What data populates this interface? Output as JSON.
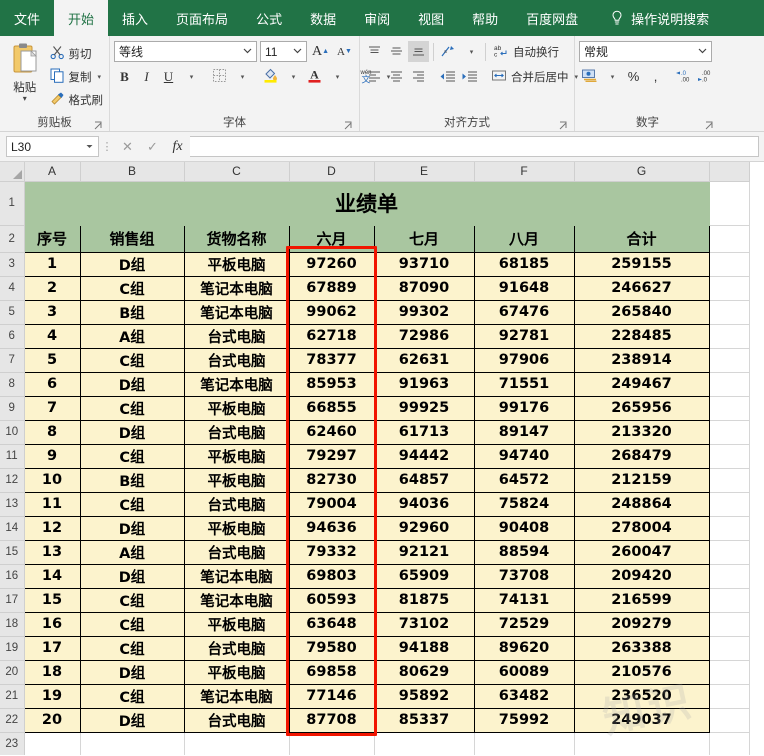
{
  "ribbon": {
    "tabs": [
      {
        "label": "文件",
        "active": false
      },
      {
        "label": "开始",
        "active": true
      },
      {
        "label": "插入",
        "active": false
      },
      {
        "label": "页面布局",
        "active": false
      },
      {
        "label": "公式",
        "active": false
      },
      {
        "label": "数据",
        "active": false
      },
      {
        "label": "审阅",
        "active": false
      },
      {
        "label": "视图",
        "active": false
      },
      {
        "label": "帮助",
        "active": false
      },
      {
        "label": "百度网盘",
        "active": false
      }
    ],
    "tellme": "操作说明搜索",
    "tellme_icon": "lightbulb-icon",
    "groups": {
      "clipboard": {
        "label": "剪贴板",
        "paste": "粘贴",
        "cut": "剪切",
        "copy": "复制",
        "format_painter": "格式刷"
      },
      "font": {
        "label": "字体",
        "font_name": "等线",
        "font_size": "11",
        "bold": "B",
        "italic": "I",
        "underline": "U",
        "grow_font": "A",
        "shrink_font": "A",
        "phonetic": "wén 文"
      },
      "alignment": {
        "label": "对齐方式",
        "wrap_text": "自动换行",
        "merge_center": "合并后居中"
      },
      "number": {
        "label": "数字",
        "format": "常规",
        "percent": "%",
        "comma": ","
      }
    }
  },
  "formula_bar": {
    "name_box": "L30",
    "cancel": "✕",
    "enter": "✓",
    "fx": "fx",
    "formula": ""
  },
  "grid": {
    "columns": [
      "A",
      "B",
      "C",
      "D",
      "E",
      "F",
      "G"
    ],
    "rows": [
      "1",
      "2",
      "3",
      "4",
      "5",
      "6",
      "7",
      "8",
      "9",
      "10",
      "11",
      "12",
      "13",
      "14",
      "15",
      "16",
      "17",
      "18",
      "19",
      "20",
      "21",
      "22",
      "23"
    ],
    "title": "业绩单",
    "headers": [
      "序号",
      "销售组",
      "货物名称",
      "六月",
      "七月",
      "八月",
      "合计"
    ],
    "data": [
      [
        "1",
        "D组",
        "平板电脑",
        "97260",
        "93710",
        "68185",
        "259155"
      ],
      [
        "2",
        "C组",
        "笔记本电脑",
        "67889",
        "87090",
        "91648",
        "246627"
      ],
      [
        "3",
        "B组",
        "笔记本电脑",
        "99062",
        "99302",
        "67476",
        "265840"
      ],
      [
        "4",
        "A组",
        "台式电脑",
        "62718",
        "72986",
        "92781",
        "228485"
      ],
      [
        "5",
        "C组",
        "台式电脑",
        "78377",
        "62631",
        "97906",
        "238914"
      ],
      [
        "6",
        "D组",
        "笔记本电脑",
        "85953",
        "91963",
        "71551",
        "249467"
      ],
      [
        "7",
        "C组",
        "平板电脑",
        "66855",
        "99925",
        "99176",
        "265956"
      ],
      [
        "8",
        "D组",
        "台式电脑",
        "62460",
        "61713",
        "89147",
        "213320"
      ],
      [
        "9",
        "C组",
        "平板电脑",
        "79297",
        "94442",
        "94740",
        "268479"
      ],
      [
        "10",
        "B组",
        "平板电脑",
        "82730",
        "64857",
        "64572",
        "212159"
      ],
      [
        "11",
        "C组",
        "台式电脑",
        "79004",
        "94036",
        "75824",
        "248864"
      ],
      [
        "12",
        "D组",
        "平板电脑",
        "94636",
        "92960",
        "90408",
        "278004"
      ],
      [
        "13",
        "A组",
        "台式电脑",
        "79332",
        "92121",
        "88594",
        "260047"
      ],
      [
        "14",
        "D组",
        "笔记本电脑",
        "69803",
        "65909",
        "73708",
        "209420"
      ],
      [
        "15",
        "C组",
        "笔记本电脑",
        "60593",
        "81875",
        "74131",
        "216599"
      ],
      [
        "16",
        "C组",
        "平板电脑",
        "63648",
        "73102",
        "72529",
        "209279"
      ],
      [
        "17",
        "C组",
        "台式电脑",
        "79580",
        "94188",
        "89620",
        "263388"
      ],
      [
        "18",
        "D组",
        "平板电脑",
        "69858",
        "80629",
        "60089",
        "210576"
      ],
      [
        "19",
        "C组",
        "笔记本电脑",
        "77146",
        "95892",
        "63482",
        "236520"
      ],
      [
        "20",
        "D组",
        "台式电脑",
        "87708",
        "85337",
        "75992",
        "249037"
      ]
    ],
    "annotation": {
      "type": "red-rectangle",
      "target_column": "D",
      "color": "#f11500"
    }
  },
  "colors": {
    "ribbon_green": "#217346",
    "header_green": "#a9c6a0",
    "data_cream": "#fcf3cd",
    "annotation_red": "#f11500"
  }
}
